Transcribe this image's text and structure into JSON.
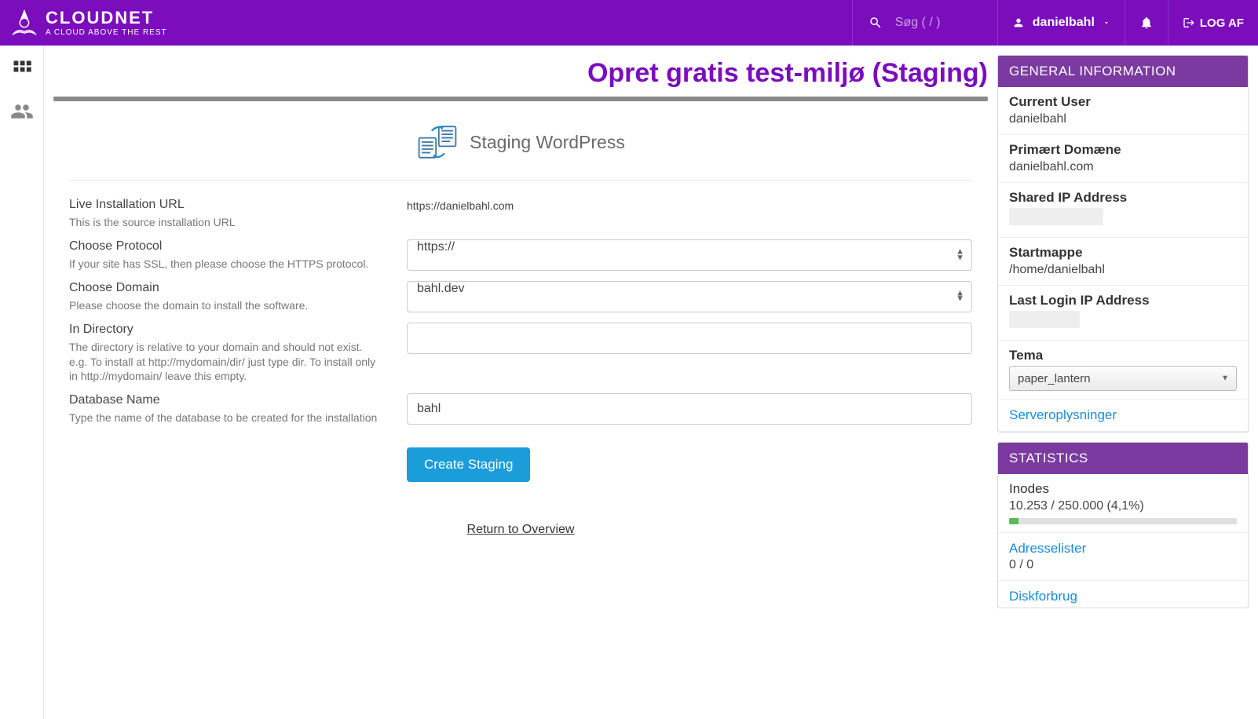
{
  "header": {
    "brand": "CLOUDNET",
    "tagline": "A CLOUD ABOVE THE REST",
    "search_placeholder": "Søg ( / )",
    "username": "danielbahl",
    "logout": "LOG AF"
  },
  "page": {
    "title": "Opret gratis test-miljø (Staging)",
    "section_title": "Staging WordPress"
  },
  "form": {
    "live_url": {
      "label": "Live Installation URL",
      "help": "This is the source installation URL",
      "value": "https://danielbahl.com"
    },
    "protocol": {
      "label": "Choose Protocol",
      "help": "If your site has SSL, then please choose the HTTPS protocol.",
      "value": "https://"
    },
    "domain": {
      "label": "Choose Domain",
      "help": "Please choose the domain to install the software.",
      "value": "bahl.dev"
    },
    "directory": {
      "label": "In Directory",
      "help": "The directory is relative to your domain and should not exist. e.g. To install at http://mydomain/dir/ just type dir. To install only in http://mydomain/ leave this empty.",
      "value": ""
    },
    "dbname": {
      "label": "Database Name",
      "help": "Type the name of the database to be created for the installation",
      "value": "bahl"
    },
    "create_button": "Create Staging",
    "return_link": "Return to Overview"
  },
  "general": {
    "heading": "GENERAL INFORMATION",
    "current_user": {
      "label": "Current User",
      "value": "danielbahl"
    },
    "primary_domain": {
      "label": "Primært Domæne",
      "value": "danielbahl.com"
    },
    "shared_ip": {
      "label": "Shared IP Address"
    },
    "home_dir": {
      "label": "Startmappe",
      "value": "/home/danielbahl"
    },
    "last_login": {
      "label": "Last Login IP Address"
    },
    "theme": {
      "label": "Tema",
      "value": "paper_lantern"
    },
    "server_info": "Serveroplysninger"
  },
  "stats": {
    "heading": "STATISTICS",
    "inodes": {
      "label": "Inodes",
      "value": "10.253 / 250.000   (4,1%)",
      "percent": 4.1
    },
    "addresses": {
      "label": "Adresselister",
      "value": "0 / 0"
    },
    "disk": {
      "label": "Diskforbrug"
    }
  }
}
